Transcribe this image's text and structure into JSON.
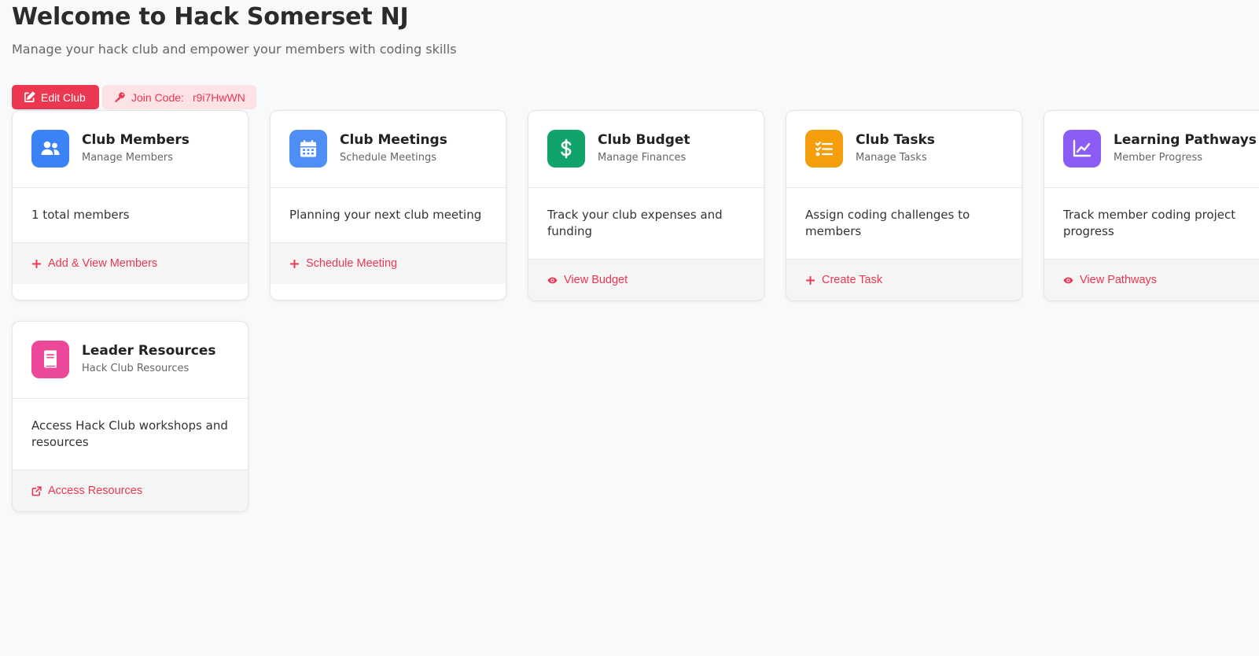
{
  "header": {
    "title": "Welcome to Hack Somerset NJ",
    "subtitle": "Manage your hack club and empower your members with coding skills"
  },
  "actions": {
    "edit_label": "Edit Club",
    "join_label": "Join Code:",
    "join_code": "r9i7HwWN"
  },
  "colors": {
    "accent": "#ec3750",
    "members": "#3b82f6",
    "meetings": "#4d8ff5",
    "budget": "#10a36b",
    "tasks": "#f59e0b",
    "pathways": "#8b5cf6",
    "resources": "#ec4899"
  },
  "cards": [
    {
      "title": "Club Members",
      "subtitle": "Manage Members",
      "body": "1 total members",
      "action": "Add & View Members",
      "icon": "users-icon",
      "action_icon": "plus-icon"
    },
    {
      "title": "Club Meetings",
      "subtitle": "Schedule Meetings",
      "body": "Planning your next club meeting",
      "action": "Schedule Meeting",
      "icon": "calendar-icon",
      "action_icon": "plus-icon"
    },
    {
      "title": "Club Budget",
      "subtitle": "Manage Finances",
      "body": "Track your club expenses and funding",
      "action": "View Budget",
      "icon": "dollar-icon",
      "action_icon": "eye-icon"
    },
    {
      "title": "Club Tasks",
      "subtitle": "Manage Tasks",
      "body": "Assign coding challenges to members",
      "action": "Create Task",
      "icon": "task-list-icon",
      "action_icon": "plus-icon"
    },
    {
      "title": "Learning Pathways",
      "subtitle": "Member Progress",
      "body": "Track member coding project progress",
      "action": "View Pathways",
      "icon": "chart-line-icon",
      "action_icon": "eye-icon"
    },
    {
      "title": "Leader Resources",
      "subtitle": "Hack Club Resources",
      "body": "Access Hack Club workshops and resources",
      "action": "Access Resources",
      "icon": "book-icon",
      "action_icon": "external-link-icon"
    }
  ]
}
